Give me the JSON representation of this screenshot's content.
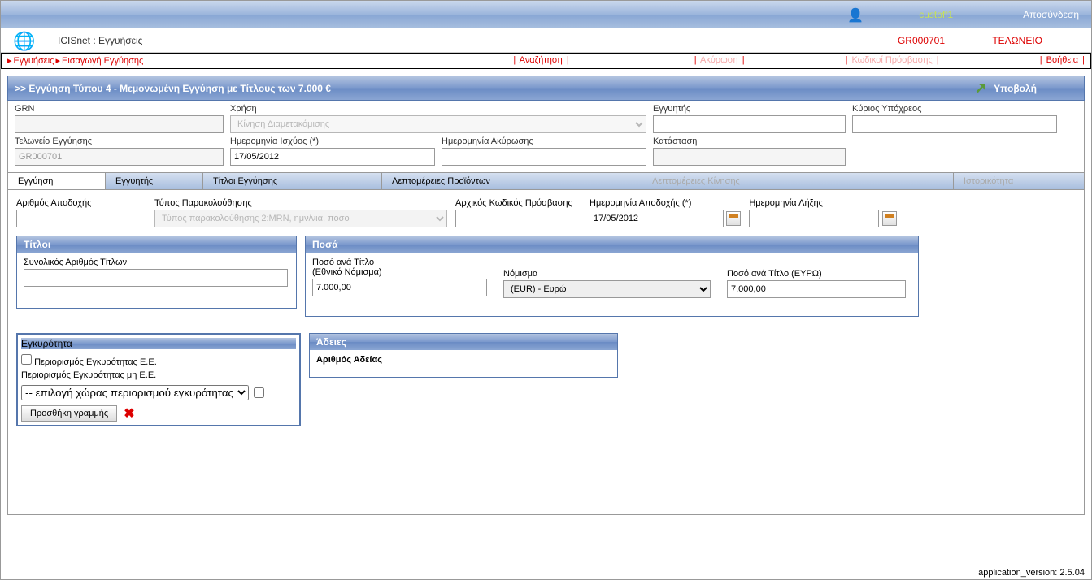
{
  "topbar": {
    "username": "custoff1",
    "logout": "Αποσύνδεση"
  },
  "header": {
    "title": "ICISnet : Εγγυήσεις",
    "code": "GR000701",
    "office": "ΤΕΛΩΝΕΙΟ"
  },
  "breadcrumb": {
    "part1": "Εγγυήσεις",
    "part2": "Εισαγωγή Εγγύησης",
    "search": "Αναζήτηση",
    "cancel": "Ακύρωση",
    "codes": "Κωδικοί Πρόσβασης",
    "help": "Βοήθεια"
  },
  "panel": {
    "title": ">> Εγγύηση Τύπου 4 - Μεμονωμένη Εγγύηση με Τίτλους των 7.000 €",
    "submit": "Υποβολή"
  },
  "form": {
    "grn_label": "GRN",
    "grn_value": "",
    "usage_label": "Χρήση",
    "usage_value": "Κίνηση Διαμετακόμισης",
    "guarantor_label": "Εγγυητής",
    "guarantor_value": "",
    "principal_label": "Κύριος Υπόχρεος",
    "principal_value": "",
    "office_label": "Τελωνείο Εγγύησης",
    "office_value": "GR000701",
    "valid_date_label": "Ημερομηνία Ισχύος (*)",
    "valid_date_value": "17/05/2012",
    "cancel_date_label": "Ημερομηνία Ακύρωσης",
    "cancel_date_value": "",
    "status_label": "Κατάσταση",
    "status_value": ""
  },
  "tabs": {
    "t1": "Εγγύηση",
    "t2": "Εγγυητής",
    "t3": "Τίτλοι Εγγύησης",
    "t4": "Λεπτομέρειες Προϊόντων",
    "t5": "Λεπτομέρειες Κίνησης",
    "t6": "Ιστορικότητα"
  },
  "inner": {
    "accept_num_label": "Αριθμός Αποδοχής",
    "accept_num_value": "",
    "monitor_type_label": "Τύπος Παρακολούθησης",
    "monitor_type_placeholder": "Τύπος παρακολούθησης 2:MRN, ημν/νια, ποσο",
    "initial_code_label": "Αρχικός Κωδικός Πρόσβασης",
    "initial_code_value": "",
    "accept_date_label": "Ημερομηνία Αποδοχής (*)",
    "accept_date_value": "17/05/2012",
    "expiry_date_label": "Ημερομηνία Λήξης",
    "expiry_date_value": ""
  },
  "titles_panel": {
    "header": "Τίτλοι",
    "total_label": "Συνολικός Αριθμός Τίτλων",
    "total_value": ""
  },
  "amounts_panel": {
    "header": "Ποσά",
    "amount_national_label1": "Ποσό ανά Τίτλο",
    "amount_national_label2": "(Εθνικό Νόμισμα)",
    "amount_national_value": "7.000,00",
    "currency_label": "Νόμισμα",
    "currency_value": "(EUR) - Ευρώ",
    "amount_euro_label": "Ποσό ανά Τίτλο (ΕΥΡΩ)",
    "amount_euro_value": "7.000,00"
  },
  "validity_panel": {
    "header": "Εγκυρότητα",
    "limit_eu": "Περιορισμός Εγκυρότητας Ε.Ε.",
    "limit_noneu": "Περιορισμός Εγκυρότητας μη Ε.Ε.",
    "country_select": "-- επιλογή χώρας περιορισμού εγκυρότητας --",
    "add_row": "Προσθήκη γραμμής"
  },
  "licenses_panel": {
    "header": "Άδειες",
    "license_num_label": "Αριθμός Αδείας"
  },
  "footer": {
    "version": "application_version: 2.5.04"
  }
}
